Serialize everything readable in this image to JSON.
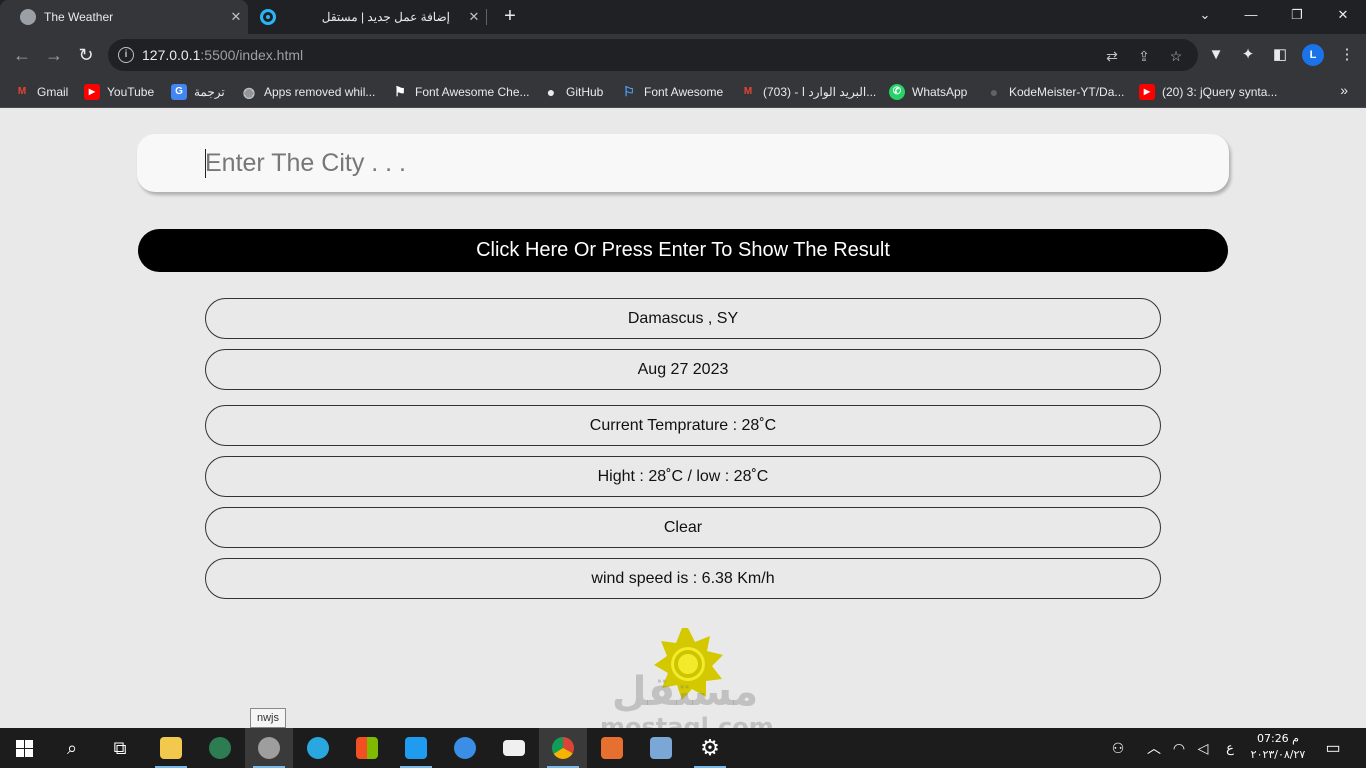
{
  "browser": {
    "tabs": [
      {
        "title": "The Weather",
        "active": true,
        "favicon_color": "#9aa0a6"
      },
      {
        "title": "إضافة عمل جديد | مستقل",
        "active": false,
        "favicon_color": "#29b6f6"
      }
    ],
    "tab_close": "✕",
    "new_tab": "+",
    "window_controls": {
      "dropdown": "⌄",
      "minimize": "—",
      "restore": "❐",
      "close": "✕"
    },
    "address": {
      "host": "127.0.0.1",
      "rest": ":5500/index.html"
    },
    "nav_icons": {
      "back": "←",
      "forward": "→",
      "reload": "↻"
    },
    "bookmarks": [
      {
        "label": "Gmail",
        "icon": "gmail-icon",
        "color": "#ea4335",
        "glyph": "M"
      },
      {
        "label": "YouTube",
        "icon": "youtube-icon",
        "color": "#ff0000",
        "glyph": "▶"
      },
      {
        "label": "ترجمة",
        "icon": "translate-icon",
        "color": "#4285f4",
        "glyph": "G"
      },
      {
        "label": "Apps removed whil...",
        "icon": "globe-icon",
        "color": "#5f6368",
        "glyph": "◍"
      },
      {
        "label": "Font Awesome Che...",
        "icon": "flag-icon",
        "color": "#202124",
        "glyph": "⚑"
      },
      {
        "label": "GitHub",
        "icon": "github-icon",
        "color": "#202124",
        "glyph": "●"
      },
      {
        "label": "Font Awesome",
        "icon": "font-awesome-icon",
        "color": "#1e88e5",
        "glyph": "⚐"
      },
      {
        "label": "(703) - البريد الوارد ا...",
        "icon": "gmail-icon",
        "color": "#ea4335",
        "glyph": "M"
      },
      {
        "label": "WhatsApp",
        "icon": "whatsapp-icon",
        "color": "#25d366",
        "glyph": "✆"
      },
      {
        "label": "KodeMeister-YT/Da...",
        "icon": "github-icon",
        "color": "#202124",
        "glyph": "●"
      },
      {
        "label": "(20) 3: jQuery synta...",
        "icon": "youtube-icon",
        "color": "#ff0000",
        "glyph": "▶"
      }
    ],
    "bookmarks_more": "»",
    "profile_initial": "L"
  },
  "weather": {
    "city_placeholder": "Enter The City . . .",
    "show_button": "Click Here Or Press Enter To Show The Result",
    "location": "Damascus , SY",
    "date": "Aug 27 2023",
    "current_temp": "Current Temprature : 28˚C",
    "high_low": "Hight : 28˚C / low : 28˚C",
    "condition": "Clear",
    "wind": "wind speed is : 6.38 Km/h",
    "icon": "sun-icon",
    "icon_color": "#d4c800"
  },
  "watermark": {
    "arabic": "مستقل",
    "latin": "mostaql.com"
  },
  "taskbar": {
    "tooltip": "nwjs",
    "clock_time": "م 07:26",
    "clock_date": "٢٠٢٣/٠٨/٢٧",
    "language": "ع"
  }
}
